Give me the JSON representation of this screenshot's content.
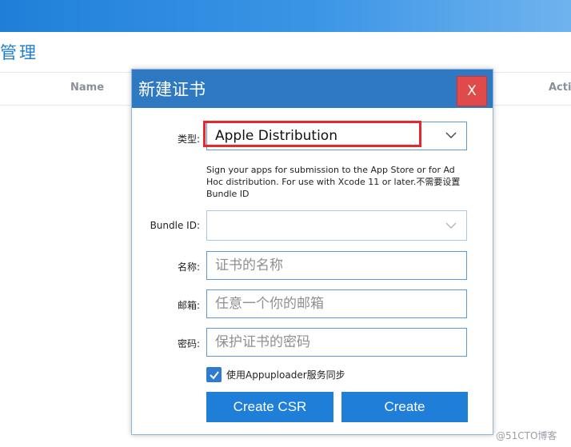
{
  "background": {
    "page_title": "管理",
    "columns": [
      "Name",
      "Acti"
    ]
  },
  "dialog": {
    "title": "新建证书",
    "close_label": "X",
    "type_label": "类型:",
    "type_value": "Apple Distribution",
    "description": "Sign your apps for submission to the App Store or for Ad Hoc distribution. For use with Xcode 11 or later.不需要设置Bundle ID",
    "bundle_label": "Bundle ID:",
    "bundle_value": "",
    "name_label": "名称:",
    "name_placeholder": "证书的名称",
    "email_label": "邮箱:",
    "email_placeholder": "任意一个你的邮箱",
    "password_label": "密码:",
    "password_placeholder": "保护证书的密码",
    "sync_label": "使用Appuploader服务同步",
    "sync_checked": true,
    "create_csr_label": "Create CSR",
    "create_label": "Create"
  },
  "watermark": "@51CTO博客",
  "colors": {
    "header_blue": "#2f79c2",
    "button_blue": "#1f7fd8",
    "close_red": "#e04a4a",
    "highlight_red": "#e8262b"
  },
  "icons": {
    "select_arrow": "chevron-down-icon",
    "checkbox": "checkmark-icon"
  }
}
